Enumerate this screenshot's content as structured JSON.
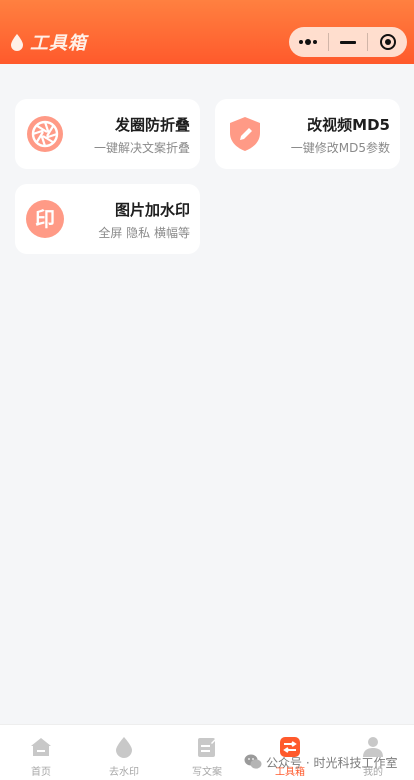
{
  "header": {
    "title": "工具箱",
    "brand_color": "#ff5a2c"
  },
  "capsule": {
    "more_icon": "more-dots-icon",
    "minimize_icon": "minimize-icon",
    "close_icon": "target-close-icon"
  },
  "tools": [
    {
      "title": "发圈防折叠",
      "subtitle": "一键解决文案折叠",
      "icon": "aperture-icon"
    },
    {
      "title": "改视频MD5",
      "subtitle": "一键修改MD5参数",
      "icon": "shield-pen-icon"
    },
    {
      "title": "图片加水印",
      "subtitle": "全屏 隐私 横幅等",
      "icon": "stamp-icon",
      "icon_text": "印"
    }
  ],
  "tabbar": {
    "items": [
      {
        "label": "首页",
        "icon": "home-icon"
      },
      {
        "label": "去水印",
        "icon": "drop-icon"
      },
      {
        "label": "写文案",
        "icon": "note-icon"
      },
      {
        "label": "工具箱",
        "icon": "toolbox-icon",
        "active": true
      },
      {
        "label": "我的",
        "icon": "user-icon"
      }
    ]
  },
  "watermark": {
    "text": "公众号 · 时光科技工作室",
    "icon": "wechat-icon"
  },
  "colors": {
    "accent": "#ff5a2c",
    "icon_tint": "#ff9a86",
    "background": "#f5f6f8"
  }
}
